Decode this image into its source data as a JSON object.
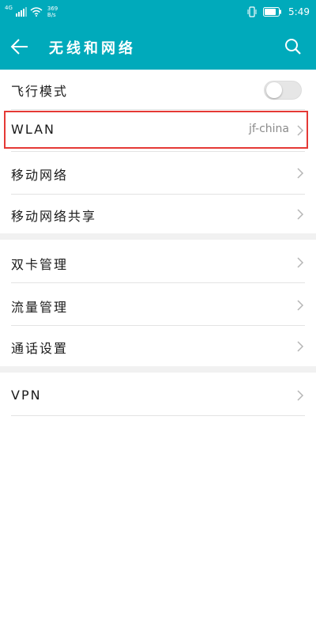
{
  "status_bar": {
    "signal_label": "4G",
    "net_speed_value": "369",
    "net_speed_unit": "B/s",
    "time": "5:49"
  },
  "app_bar": {
    "title": "无线和网络",
    "back_icon": "back-arrow-icon",
    "search_icon": "search-icon"
  },
  "settings": {
    "airplane_mode": {
      "label": "飞行模式",
      "enabled": false
    },
    "wlan": {
      "label": "WLAN",
      "value": "jf-china"
    },
    "mobile_network": {
      "label": "移动网络"
    },
    "tethering": {
      "label": "移动网络共享"
    },
    "dual_sim": {
      "label": "双卡管理"
    },
    "data_usage": {
      "label": "流量管理"
    },
    "call_settings": {
      "label": "通话设置"
    },
    "vpn": {
      "label": "VPN"
    }
  },
  "colors": {
    "accent": "#00aabb",
    "highlight": "#e53935"
  }
}
